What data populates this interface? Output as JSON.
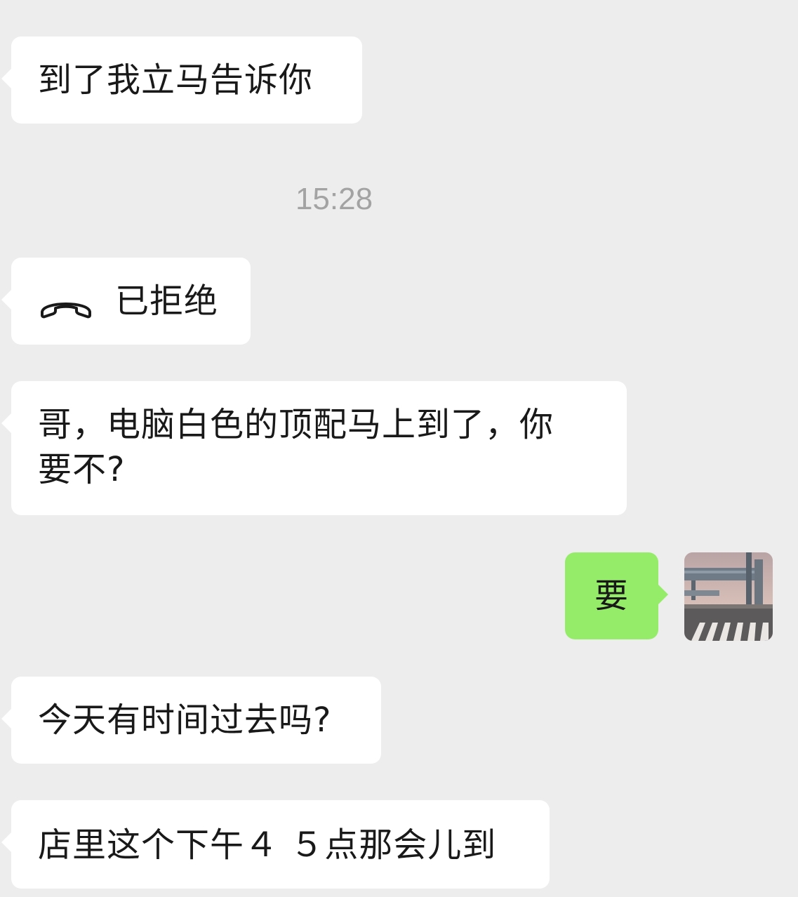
{
  "messages": {
    "m1": {
      "text": "到了我立马告诉你"
    },
    "timestamp": "15:28",
    "call": {
      "status": "已拒绝",
      "icon": "phone-hangup-icon"
    },
    "m3": {
      "line1": "哥，电脑白色的顶配马上到了，你",
      "line2": "要不?"
    },
    "m4": {
      "text": "要"
    },
    "m5": {
      "text": "今天有时间过去吗?"
    },
    "m6": {
      "text": "店里这个下午４ ５点那会儿到"
    }
  },
  "colors": {
    "background": "#ededed",
    "incoming_bubble": "#ffffff",
    "outgoing_bubble": "#95ec69",
    "timestamp": "#a3a3a3"
  }
}
